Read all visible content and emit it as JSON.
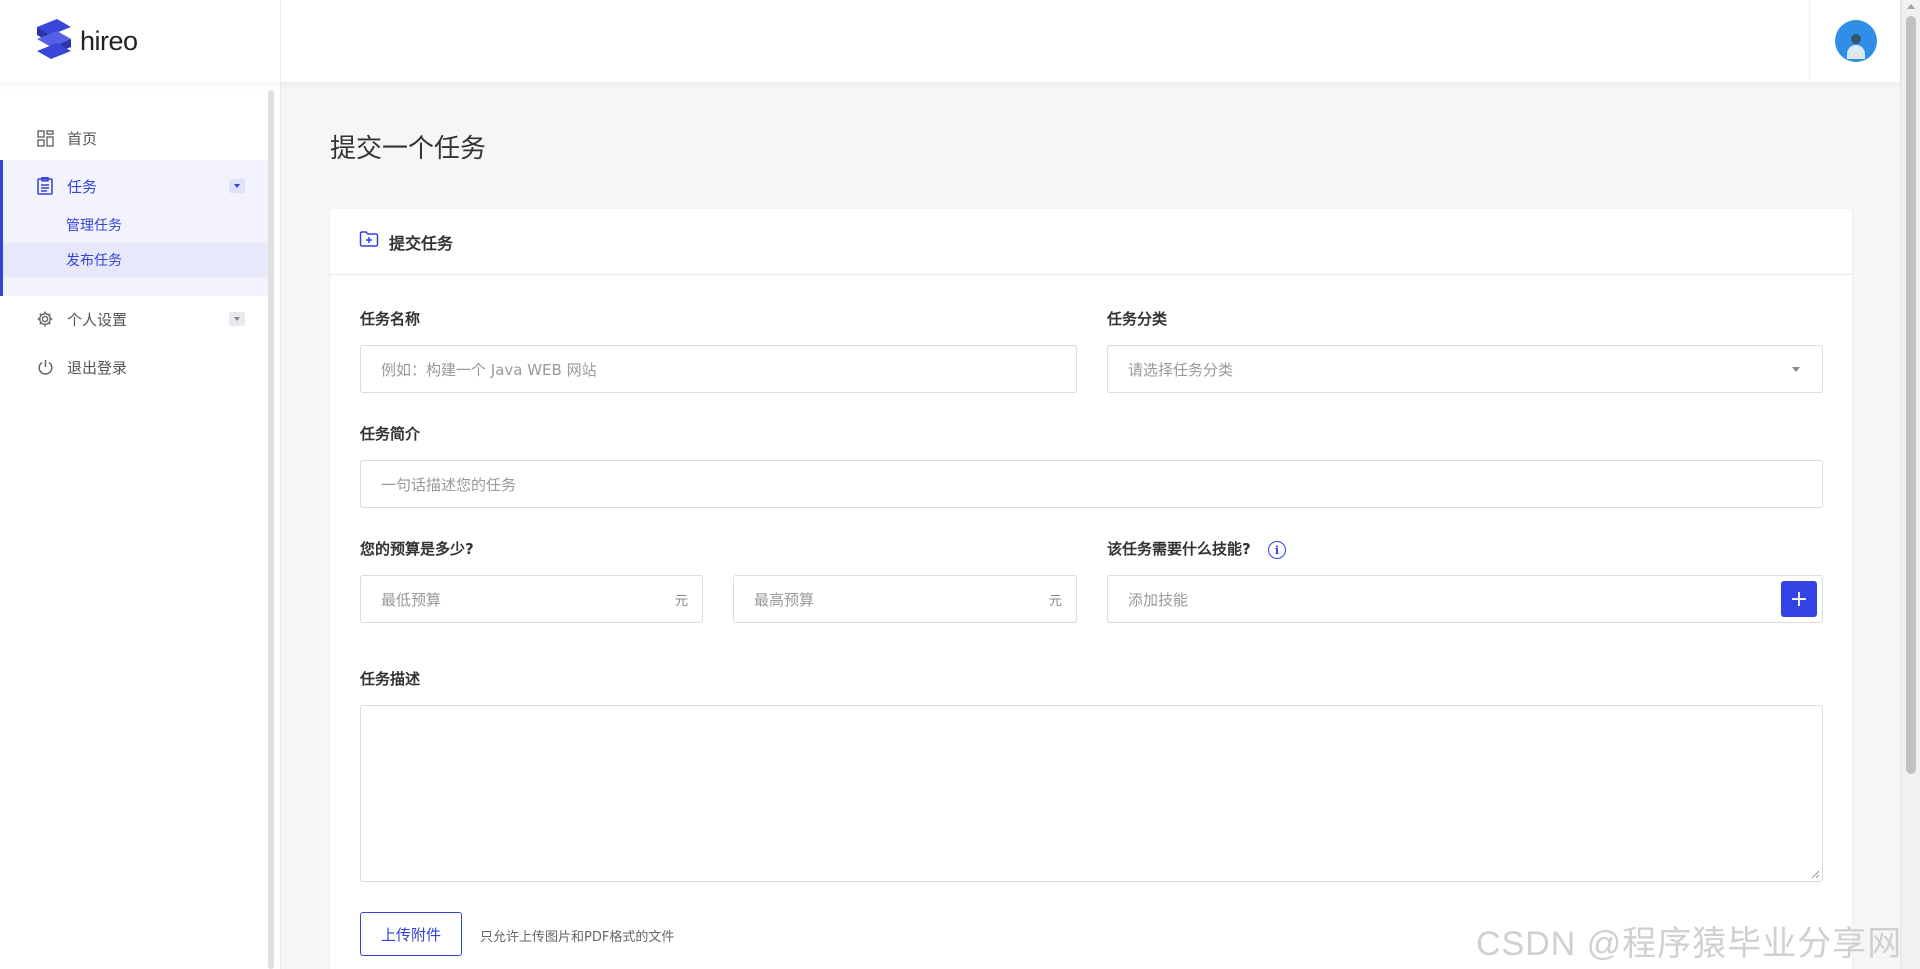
{
  "brand": {
    "name": "hireo",
    "avatar_icon": "user-avatar-icon",
    "accent_color": "#3343d5"
  },
  "sidebar": {
    "items": [
      {
        "label": "首页",
        "icon": "dashboard-icon"
      },
      {
        "label": "任务",
        "icon": "clipboard-icon",
        "expanded": true,
        "children": [
          {
            "label": "管理任务"
          },
          {
            "label": "发布任务",
            "active": true
          }
        ]
      },
      {
        "label": "个人设置",
        "icon": "gear-icon"
      },
      {
        "label": "退出登录",
        "icon": "power-icon"
      }
    ]
  },
  "page": {
    "title": "提交一个任务"
  },
  "form": {
    "card_title": "提交任务",
    "task_name": {
      "label": "任务名称",
      "placeholder": "例如：构建一个 Java WEB 网站"
    },
    "category": {
      "label": "任务分类",
      "placeholder": "请选择任务分类"
    },
    "summary": {
      "label": "任务简介",
      "placeholder": "一句话描述您的任务"
    },
    "budget": {
      "label": "您的预算是多少?",
      "min_placeholder": "最低预算",
      "max_placeholder": "最高预算",
      "unit": "元"
    },
    "skills": {
      "label": "该任务需要什么技能?",
      "placeholder": "添加技能",
      "add_symbol": "+",
      "info_symbol": "i"
    },
    "description": {
      "label": "任务描述"
    },
    "upload": {
      "button_label": "上传附件",
      "hint": "只允许上传图片和PDF格式的文件"
    }
  },
  "watermark": "CSDN @程序猿毕业分享网"
}
